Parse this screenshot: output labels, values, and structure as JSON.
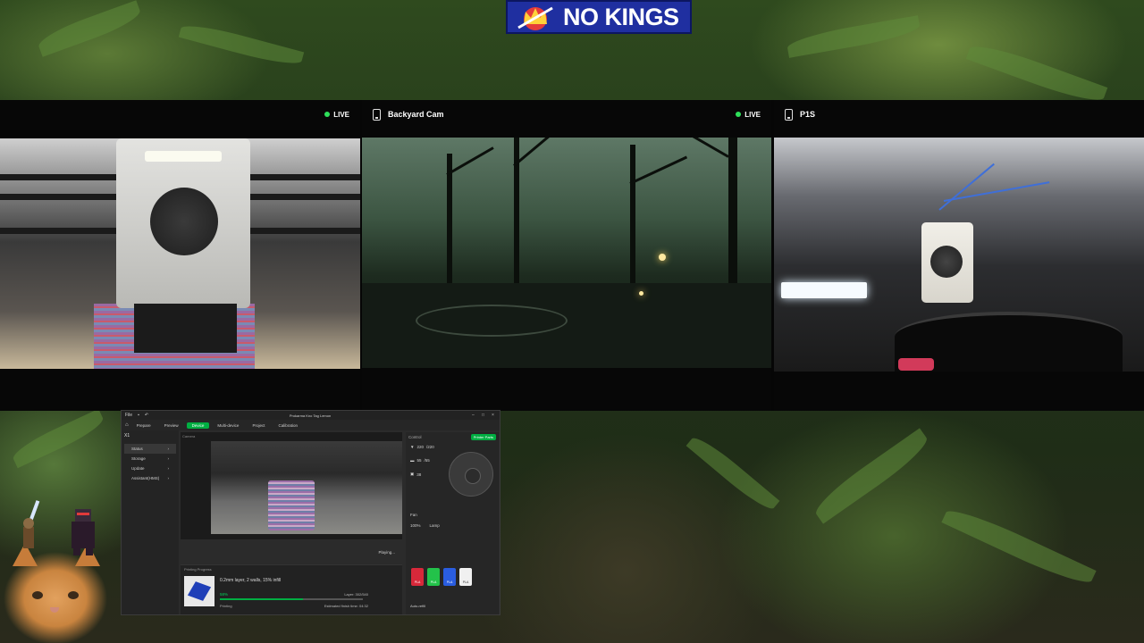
{
  "banner": {
    "text": "NO KINGS"
  },
  "cameras": [
    {
      "name": "",
      "live_label": "LIVE"
    },
    {
      "name": "Backyard Cam",
      "live_label": "LIVE"
    },
    {
      "name": "P1S",
      "live_label": ""
    }
  ],
  "studio": {
    "title": "Prokarma Kno Tag Lemon",
    "menu": "File",
    "tabs": [
      {
        "label": "Prepare"
      },
      {
        "label": "Preview"
      },
      {
        "label": "Device"
      },
      {
        "label": "Multi-device"
      },
      {
        "label": "Project"
      },
      {
        "label": "Calibration"
      }
    ],
    "device_name": "X1",
    "sidebar": [
      {
        "label": "Status"
      },
      {
        "label": "Storage"
      },
      {
        "label": "Update"
      },
      {
        "label": "Assistant(HMS)"
      }
    ],
    "camera_label": "Camera",
    "playing_label": "Playing...",
    "printing_progress_label": "Printing Progress",
    "job_description": "0.2mm layer, 2 walls, 15% infill",
    "percent": "58%",
    "stage": "Printing",
    "layer": "Layer: 302/540",
    "eta": "Estimated finish time: 04:32",
    "progress_fraction": 0.58,
    "control": {
      "title": "Control",
      "printer_parts": "Printer Parts",
      "nozzle_temp": "220",
      "nozzle_target": "/220",
      "bed_temp": "55",
      "bed_target": "/55",
      "chamber_temp": "38",
      "fan_label": "Fan",
      "speed_label": "100%",
      "lamp_label": "Lamp",
      "ams_slots": [
        {
          "label": "PLA",
          "color": "#d8283a"
        },
        {
          "label": "PLA",
          "color": "#23c24a"
        },
        {
          "label": "PLA",
          "color": "#2a5de0"
        },
        {
          "label": "PLA",
          "color": "#f0f0f0"
        }
      ],
      "auto_refill": "Auto-refill"
    }
  }
}
